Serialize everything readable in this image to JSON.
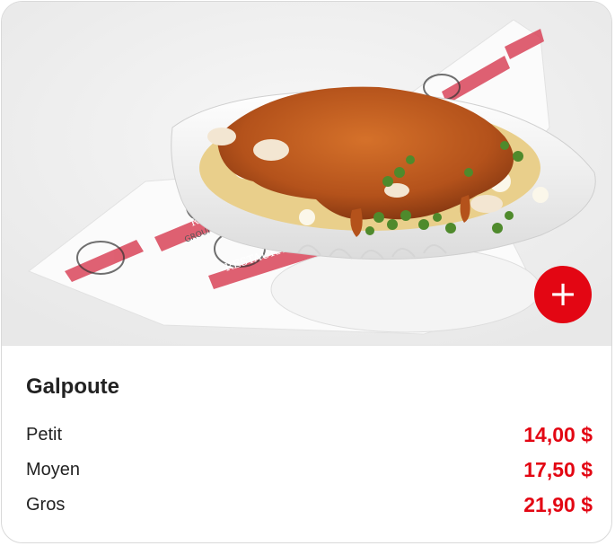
{
  "product": {
    "title": "Galpoute",
    "image_alt": "Galpoute",
    "add_label": "+",
    "sizes": [
      {
        "name": "Petit",
        "price": "14,00 $"
      },
      {
        "name": "Moyen",
        "price": "17,50 $"
      },
      {
        "name": "Gros",
        "price": "21,90 $"
      }
    ]
  },
  "wrapper_text": {
    "brand": "RESTAURANTS",
    "subbrand": "GROUPE VILLAGEOIS"
  },
  "colors": {
    "accent": "#e30613",
    "text": "#222222",
    "border": "#d9d9d9"
  },
  "icons": {
    "add": "plus-icon"
  }
}
